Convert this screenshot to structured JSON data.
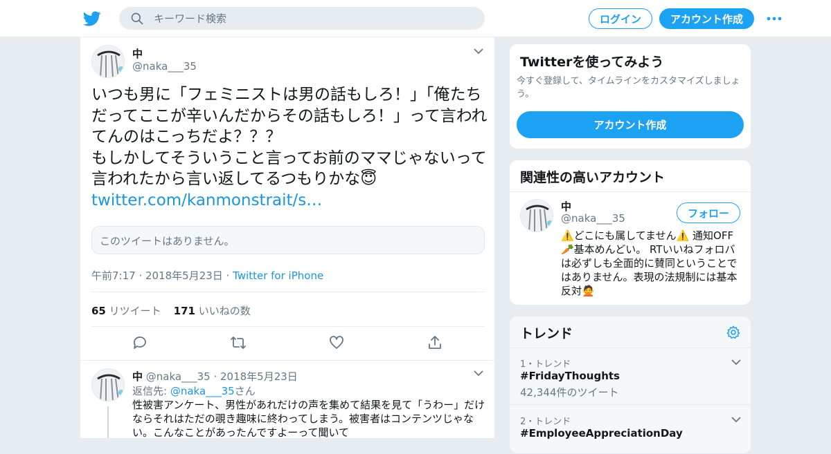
{
  "header": {
    "search_placeholder": "キーワード検索",
    "login_label": "ログイン",
    "signup_label": "アカウント作成"
  },
  "tweet": {
    "display_name": "中",
    "handle": "@naka___35",
    "text": "いつも男に「フェミニストは男の話もしろ！」「俺たちだってここが辛いんだからその話もしろ！」って言われてんのはこっちだよ？？？\nもしかしてそういうこと言ってお前のママじゃないって言われたから言い返してるつもりかな😇",
    "link": "twitter.com/kanmonstrait/s…",
    "quote_unavailable": "このツイートはありません。",
    "timestamp": "午前7:17 · 2018年5月23日 · ",
    "source": "Twitter for iPhone",
    "retweet_count": "65",
    "retweet_label": "リツイート",
    "like_count": "171",
    "like_label": "いいねの数"
  },
  "reply": {
    "display_name": "中",
    "handle_date": "@naka___35 · 2018年5月23日",
    "reply_to_prefix": "返信先: ",
    "reply_to_handle": "@naka___35",
    "reply_to_suffix": "さん",
    "text": "性被害アンケート、男性があれだけの声を集めて結果を見て「うわー」だけならそれはただの覗き趣味に終わってしまう。被害者はコンテンツじゃない。こんなことがあったんですよーって聞いて"
  },
  "sidebar": {
    "signup_card": {
      "title": "Twitterを使ってみよう",
      "description": "今すぐ登録して、タイムラインをカスタマイズしましょう。",
      "button": "アカウント作成"
    },
    "related_card": {
      "title": "関連性の高いアカウント",
      "name": "中",
      "handle": "@naka___35",
      "follow_label": "フォロー",
      "bio": "⚠️どこにも属してません⚠️ 通知OFF🥕基本めんどい。 RTいいねフォロバは必ずしも全面的に賛同ということではありません。表現の法規制には基本反対🙅"
    },
    "trends_card": {
      "title": "トレンド",
      "items": [
        {
          "rank": "1・トレンド",
          "name": "#FridayThoughts",
          "count": "42,344件のツイート"
        },
        {
          "rank": "2・トレンド",
          "name": "#EmployeeAppreciationDay",
          "count": ""
        }
      ]
    }
  },
  "colors": {
    "brand_blue": "#1da1f2",
    "link_blue": "#1b95e0",
    "muted_gray": "#657786",
    "background": "#e6ecf0"
  },
  "icons": [
    "twitter-logo-icon",
    "search-icon",
    "more-dots-icon",
    "chevron-down-icon",
    "reply-icon",
    "retweet-icon",
    "like-icon",
    "share-icon",
    "gear-icon"
  ]
}
